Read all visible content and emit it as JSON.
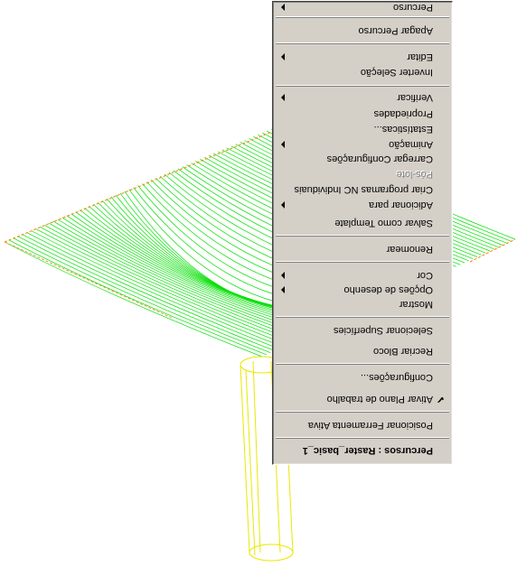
{
  "context_menu": {
    "title": "Percursos : Raster_basic_1",
    "items": [
      {
        "label": "Posicionar Ferramenta Ativa"
      },
      {
        "label": "Ativar Plano de trabalho",
        "checked": true
      },
      {
        "label": "Configurações..."
      },
      {
        "label": "Recriar Bloco"
      },
      {
        "label": "Selecionar Superfícies"
      },
      {
        "label": "Mostrar"
      },
      {
        "label": "Opções de desenho",
        "submenu": true
      },
      {
        "label": "Cor",
        "submenu": true
      },
      {
        "label": "Renomear"
      },
      {
        "label": "Salvar como Template"
      },
      {
        "label": "Adicionar para",
        "submenu": true
      },
      {
        "label": "Criar programas NC Individuais"
      },
      {
        "label": "Pós-lote",
        "disabled": true
      },
      {
        "label": "Carregar Configurações"
      },
      {
        "label": "Animação",
        "submenu": true
      },
      {
        "label": "Estatísticas..."
      },
      {
        "label": "Propriedades"
      },
      {
        "label": "Verificar",
        "submenu": true
      },
      {
        "label": "Inverter Seleção"
      },
      {
        "label": "Editar",
        "submenu": true
      },
      {
        "label": "Apagar Percurso"
      },
      {
        "label": "Percurso",
        "submenu": true
      }
    ]
  },
  "colors": {
    "toolpath": "#00e000",
    "tool": "#e8e800",
    "stock_outline": "#ff8000",
    "menu_bg": "#d4d0c8"
  }
}
